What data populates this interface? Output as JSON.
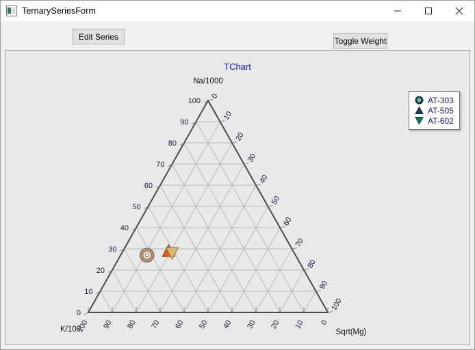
{
  "window": {
    "title": "TernarySeriesForm",
    "icon": "app-window-icon",
    "controls": {
      "minimize": "minimize-icon",
      "maximize": "maximize-icon",
      "close": "close-icon"
    }
  },
  "toolbar": {
    "edit_series_label": "Edit Series",
    "toggle_weight_label": "Toggle Weight"
  },
  "chart": {
    "title": "TChart",
    "title_color": "#1414d2",
    "background": "#e9e9e9",
    "legend": {
      "position": "top-right",
      "entries": [
        {
          "label": "AT-303",
          "marker": "circle-donut",
          "color": "#0a5a5a"
        },
        {
          "label": "AT-505",
          "marker": "triangle-up",
          "color": "#1c3f5e"
        },
        {
          "label": "AT-602",
          "marker": "triangle-down",
          "color": "#0c7a5a"
        }
      ]
    }
  },
  "chart_data": {
    "type": "scatter",
    "plot": "ternary",
    "title": "TChart",
    "axes": [
      {
        "name": "top",
        "label": "Na/1000",
        "ticks": [
          0,
          10,
          20,
          30,
          40,
          50,
          60,
          70,
          80,
          90,
          100
        ],
        "side": "left-edge",
        "direction": "bottom-to-top"
      },
      {
        "name": "right",
        "label": "Sqrt(Mg)",
        "ticks": [
          0,
          10,
          20,
          30,
          40,
          50,
          60,
          70,
          80,
          90,
          100
        ],
        "side": "right-edge",
        "direction": "top-to-bottom"
      },
      {
        "name": "bottom",
        "label": "K/100",
        "ticks": [
          100,
          90,
          80,
          70,
          60,
          50,
          40,
          30,
          20,
          10,
          0
        ],
        "side": "bottom-edge",
        "direction": "left-to-right"
      }
    ],
    "left_axis_ticks": [
      "0",
      "10",
      "20",
      "30",
      "40",
      "50",
      "60",
      "70",
      "80",
      "90",
      "100"
    ],
    "right_axis_ticks": [
      "0",
      "10",
      "20",
      "30",
      "40",
      "50",
      "60",
      "70",
      "80",
      "90",
      "100"
    ],
    "bottom_axis_ticks": [
      "100",
      "90",
      "80",
      "70",
      "60",
      "50",
      "40",
      "30",
      "20",
      "10",
      "0"
    ],
    "vertex_labels": {
      "top": "Na/1000",
      "bottom_left": "K/100",
      "bottom_right": "Sqrt(Mg)"
    },
    "grid": true,
    "grid_step": 10,
    "series": [
      {
        "name": "AT-303",
        "marker": "circle-donut",
        "color": "#c8925a",
        "points": [
          {
            "a": 27,
            "b": 11,
            "c": 62
          }
        ]
      },
      {
        "name": "AT-505",
        "marker": "triangle-up",
        "color": "#e2601f",
        "points": [
          {
            "a": 29,
            "b": 19,
            "c": 52
          }
        ]
      },
      {
        "name": "AT-602",
        "marker": "triangle-down",
        "color": "#d8b877",
        "points": [
          {
            "a": 28,
            "b": 21,
            "c": 51
          }
        ]
      }
    ]
  }
}
